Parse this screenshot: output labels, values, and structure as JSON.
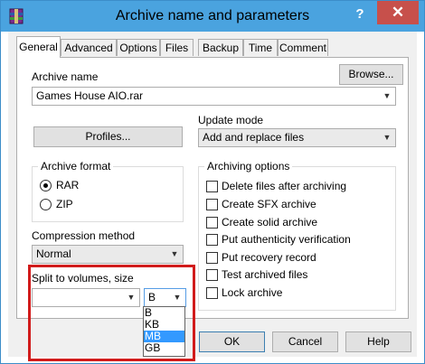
{
  "window": {
    "title": "Archive name and parameters",
    "help_label": "?",
    "close_label": "✕",
    "app_icon": "winrar-icon"
  },
  "tabs": [
    {
      "label": "General",
      "active": true
    },
    {
      "label": "Advanced"
    },
    {
      "label": "Options"
    },
    {
      "label": "Files"
    },
    {
      "label": "Backup"
    },
    {
      "label": "Time"
    },
    {
      "label": "Comment"
    }
  ],
  "general": {
    "archive_name_label": "Archive name",
    "browse_label": "Browse...",
    "archive_name_value": "Games House AIO.rar",
    "update_mode_label": "Update mode",
    "update_mode_value": "Add and replace files",
    "profiles_label": "Profiles...",
    "archive_format": {
      "title": "Archive format",
      "options": [
        "RAR",
        "ZIP"
      ],
      "selected": "RAR"
    },
    "compression": {
      "label": "Compression method",
      "value": "Normal"
    },
    "split": {
      "label": "Split to volumes, size",
      "size_value": "",
      "unit_value": "B",
      "unit_options": [
        "B",
        "KB",
        "MB",
        "GB"
      ],
      "highlighted_option": "MB"
    },
    "archiving_options": {
      "title": "Archiving options",
      "items": [
        {
          "label": "Delete files after archiving",
          "checked": false
        },
        {
          "label": "Create SFX archive",
          "checked": false
        },
        {
          "label": "Create solid archive",
          "checked": false
        },
        {
          "label": "Put authenticity verification",
          "checked": false
        },
        {
          "label": "Put recovery record",
          "checked": false
        },
        {
          "label": "Test archived files",
          "checked": false
        },
        {
          "label": "Lock archive",
          "checked": false
        }
      ]
    }
  },
  "footer": {
    "ok_label": "OK",
    "cancel_label": "Cancel",
    "help_label": "Help"
  },
  "colors": {
    "titlebar": "#4aa3df",
    "close": "#c7504b",
    "highlight_box": "#d11b1b",
    "selection": "#3399ff"
  }
}
